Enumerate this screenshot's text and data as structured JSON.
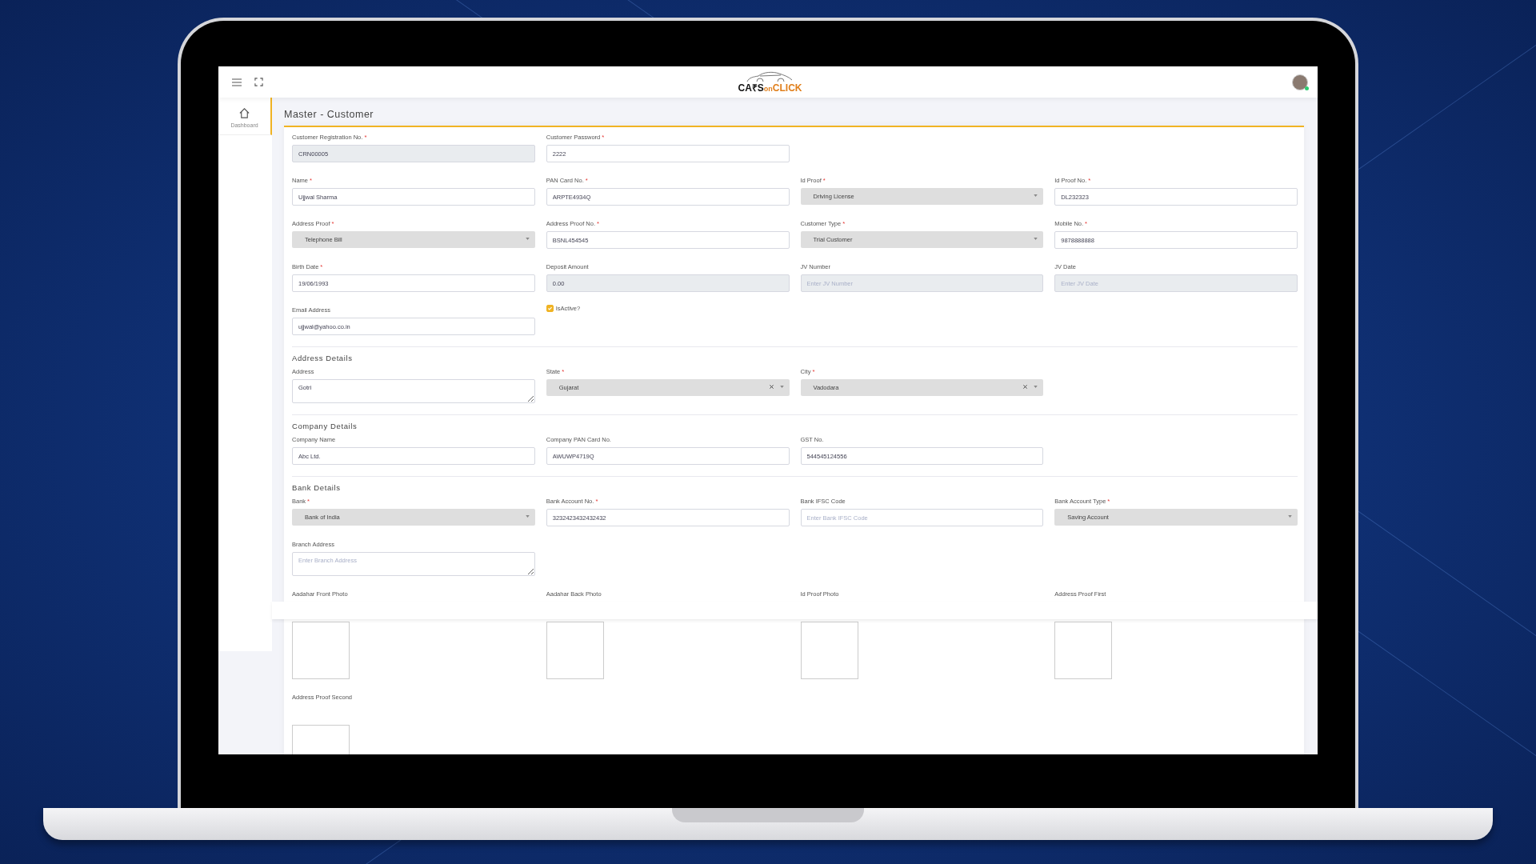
{
  "header": {
    "logo": {
      "part1": "CA₹S",
      "part2": "on",
      "part3": "CLICK"
    }
  },
  "sidebar": {
    "items": [
      {
        "label": "Dashboard",
        "selected": true
      }
    ]
  },
  "page_title": "Master - Customer",
  "sections": [
    {
      "rows": [
        [
          {
            "kind": "readonly",
            "label": "Customer Registration No.",
            "required_mark": "*",
            "value": "CRN00005"
          },
          {
            "kind": "text",
            "label": "Customer Password",
            "required_mark": "*",
            "value": "2222"
          }
        ],
        [
          {
            "kind": "text",
            "label": "Name",
            "required_mark": "*",
            "value": "Ujjwal Sharma"
          },
          {
            "kind": "text",
            "label": "PAN Card No.",
            "required_mark": "*",
            "value": "ARPTE4934Q"
          },
          {
            "kind": "select",
            "label": "Id Proof",
            "required_mark": "*",
            "value": "Driving License",
            "clearable": false
          },
          {
            "kind": "text",
            "label": "Id Proof No.",
            "required_mark": "*",
            "value": "DL232323"
          }
        ],
        [
          {
            "kind": "select",
            "label": "Address Proof",
            "required_mark": "*",
            "value": "Telephone Bill",
            "clearable": false
          },
          {
            "kind": "text",
            "label": "Address Proof No.",
            "required_mark": "*",
            "value": "BSNL454545"
          },
          {
            "kind": "select",
            "label": "Customer Type",
            "required_mark": "*",
            "value": "Trial Customer",
            "clearable": false
          },
          {
            "kind": "text",
            "label": "Mobile No.",
            "required_mark": "*",
            "value": "9878888888"
          }
        ],
        [
          {
            "kind": "text",
            "label": "Birth Date",
            "required_mark": "*",
            "value": "19/06/1993"
          },
          {
            "kind": "readonly",
            "label": "Deposit Amount",
            "value": "0.00"
          },
          {
            "kind": "readonly",
            "label": "JV Number",
            "placeholder": "Enter JV Number"
          },
          {
            "kind": "readonly",
            "label": "JV Date",
            "placeholder": "Enter JV Date"
          }
        ],
        [
          {
            "kind": "text",
            "label": "Email Address",
            "value": "ujjwal@yahoo.co.in"
          },
          {
            "kind": "checkbox",
            "label": "IsActive?",
            "checked": true
          }
        ]
      ]
    },
    {
      "title": "Address Details",
      "rows": [
        [
          {
            "kind": "textarea",
            "label": "Address",
            "value": "Gotri"
          },
          {
            "kind": "select",
            "label": "State",
            "required_mark": "*",
            "value": "Gujarat",
            "clearable": true
          },
          {
            "kind": "select",
            "label": "City",
            "required_mark": "*",
            "value": "Vadodara",
            "clearable": true
          }
        ]
      ]
    },
    {
      "title": "Company Details",
      "rows": [
        [
          {
            "kind": "text",
            "label": "Company Name",
            "value": "Abc Ltd."
          },
          {
            "kind": "text",
            "label": "Company PAN Card No.",
            "value": "AWUWP4719Q"
          },
          {
            "kind": "text",
            "label": "GST No.",
            "value": "544545124556"
          }
        ]
      ]
    },
    {
      "title": "Bank Details",
      "rows": [
        [
          {
            "kind": "select",
            "label": "Bank",
            "required_mark": "*",
            "value": "Bank of India",
            "clearable": false
          },
          {
            "kind": "text",
            "label": "Bank Account No.",
            "required_mark": "*",
            "value": "3232423432432432"
          },
          {
            "kind": "text",
            "label": "Bank IFSC Code",
            "placeholder": "Enter Bank IFSC Code"
          },
          {
            "kind": "select",
            "label": "Bank Account Type",
            "required_mark": "*",
            "value": "Saving Account",
            "clearable": false
          }
        ],
        [
          {
            "kind": "textarea",
            "label": "Branch Address",
            "placeholder": "Enter Branch Address"
          }
        ],
        [
          {
            "kind": "photo",
            "label": "Aadahar Front Photo"
          },
          {
            "kind": "photo",
            "label": "Aadahar Back Photo"
          },
          {
            "kind": "photo",
            "label": "Id Proof Photo"
          },
          {
            "kind": "photo",
            "label": "Address Proof First"
          }
        ],
        [
          {
            "kind": "photo",
            "label": "Address Proof Second"
          }
        ]
      ]
    }
  ]
}
